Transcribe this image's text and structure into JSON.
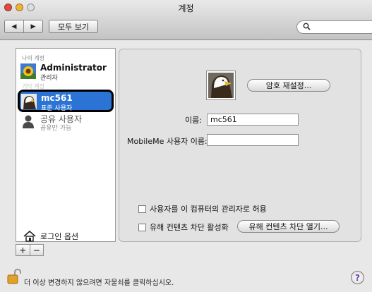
{
  "window": {
    "title": "계정"
  },
  "toolbar": {
    "back_glyph": "◀",
    "forward_glyph": "▶",
    "show_all_label": "모두 보기",
    "search_placeholder": ""
  },
  "sidebar": {
    "my_account_header": "나의 계정",
    "other_accounts_header": "기타 계정",
    "users": [
      {
        "name": "Administrator",
        "role": "관리자",
        "icon": "sunflower-icon"
      },
      {
        "name": "mc561",
        "role": "표준 사용자",
        "icon": "eagle-icon",
        "selected": true
      },
      {
        "name": "공유 사용자",
        "role": "공유만 가능",
        "icon": "user-silhouette-icon"
      }
    ],
    "login_options_label": "로그인 옵션",
    "add_label": "+",
    "remove_label": "−"
  },
  "detail": {
    "reset_password_label": "암호 재설정...",
    "name_label": "이름:",
    "name_value": "mc561",
    "mobileme_label": "MobileMe 사용자 이름:",
    "mobileme_value": "",
    "allow_admin_label": "사용자를 이 컴퓨터의 관리자로 허용",
    "allow_admin_checked": false,
    "parental_label": "유해 컨텐츠 차단 활성화",
    "parental_checked": false,
    "open_parental_label": "유해 컨텐츠 차단 열기..."
  },
  "footer": {
    "lock_text": "더 이상 변경하지 않으려면 자물쇠를 클릭하십시오.",
    "help_label": "?"
  },
  "colors": {
    "selection": "#2b74d6",
    "accent": "#6a3fa8"
  }
}
